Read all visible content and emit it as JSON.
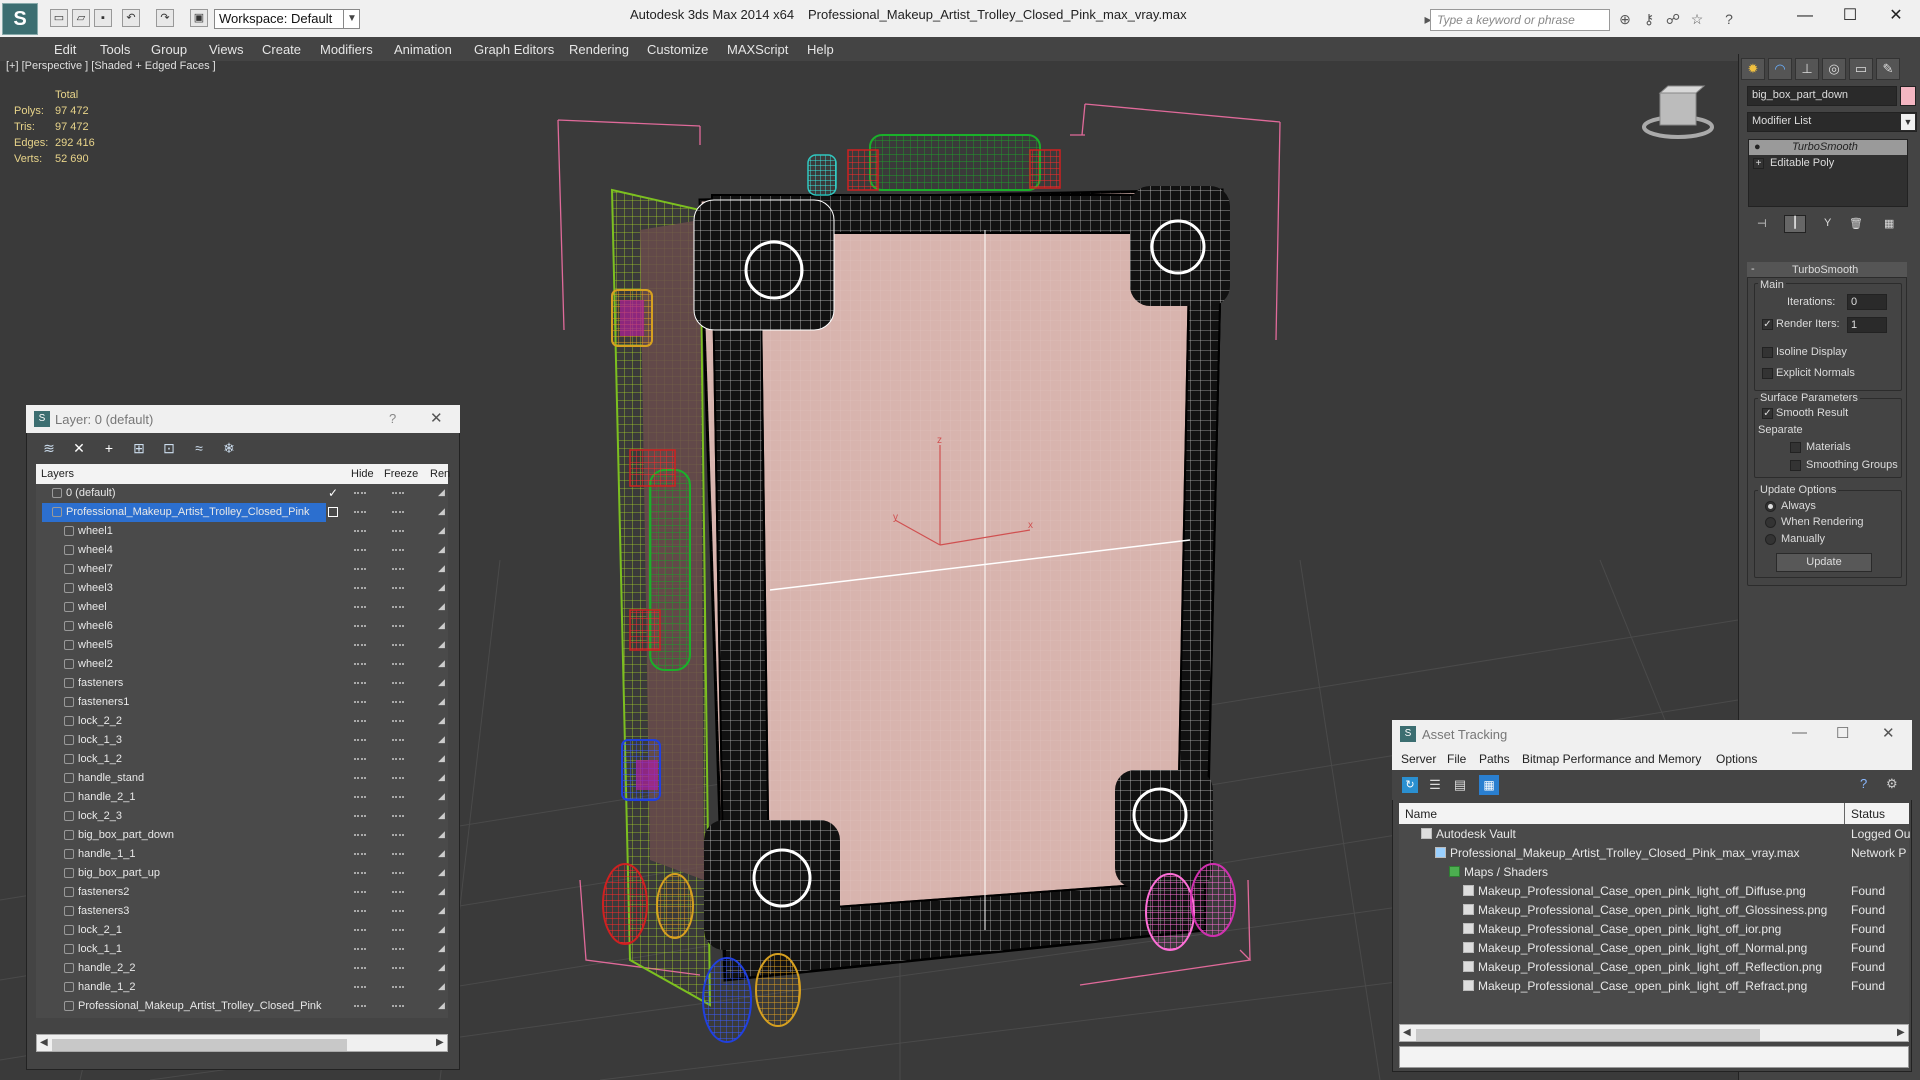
{
  "titlebar": {
    "workspace": "Workspace: Default",
    "app_title": "Autodesk 3ds Max  2014 x64",
    "file_title": "Professional_Makeup_Artist_Trolley_Closed_Pink_max_vray.max",
    "search_placeholder": "Type a keyword or phrase"
  },
  "menu": [
    "Edit",
    "Tools",
    "Group",
    "Views",
    "Create",
    "Modifiers",
    "Animation",
    "Graph Editors",
    "Rendering",
    "Customize",
    "MAXScript",
    "Help"
  ],
  "viewport": {
    "label": "[+] [Perspective ] [Shaded + Edged Faces ]",
    "stats_header": "Total",
    "stats": [
      {
        "label": "Polys:",
        "value": "97 472"
      },
      {
        "label": "Tris:",
        "value": "97 472"
      },
      {
        "label": "Edges:",
        "value": "292 416"
      },
      {
        "label": "Verts:",
        "value": "52 690"
      }
    ],
    "axis_labels": {
      "z": "z",
      "y": "y",
      "x": "x"
    }
  },
  "command_panel": {
    "object_name": "big_box_part_down",
    "object_color": "#f4b6c2",
    "modifier_list": "Modifier List",
    "stack": [
      "TurboSmooth",
      "Editable Poly"
    ],
    "rollout_title": "TurboSmooth",
    "main_label": "Main",
    "iterations_label": "Iterations:",
    "iterations_value": "0",
    "render_iters_label": "Render Iters:",
    "render_iters_value": "1",
    "isoline": "Isoline Display",
    "explicit_normals": "Explicit Normals",
    "surface_params": "Surface Parameters",
    "smooth_result": "Smooth Result",
    "separate": "Separate",
    "materials": "Materials",
    "smoothing_groups": "Smoothing Groups",
    "update_options": "Update Options",
    "always": "Always",
    "when_rendering": "When Rendering",
    "manually": "Manually",
    "update_button": "Update"
  },
  "layer_window": {
    "title": "Layer: 0 (default)",
    "help": "?",
    "headers": {
      "layers": "Layers",
      "hide": "Hide",
      "freeze": "Freeze",
      "render": "Ren"
    },
    "layers": [
      {
        "name": "0 (default)",
        "indent": 1,
        "kind": "layer",
        "checked": true
      },
      {
        "name": "Professional_Makeup_Artist_Trolley_Closed_Pink",
        "indent": 1,
        "kind": "layer",
        "selected": true
      },
      {
        "name": "wheel1",
        "indent": 2,
        "kind": "obj"
      },
      {
        "name": "wheel4",
        "indent": 2,
        "kind": "obj"
      },
      {
        "name": "wheel7",
        "indent": 2,
        "kind": "obj"
      },
      {
        "name": "wheel3",
        "indent": 2,
        "kind": "obj"
      },
      {
        "name": "wheel",
        "indent": 2,
        "kind": "obj"
      },
      {
        "name": "wheel6",
        "indent": 2,
        "kind": "obj"
      },
      {
        "name": "wheel5",
        "indent": 2,
        "kind": "obj"
      },
      {
        "name": "wheel2",
        "indent": 2,
        "kind": "obj"
      },
      {
        "name": "fasteners",
        "indent": 2,
        "kind": "obj"
      },
      {
        "name": "fasteners1",
        "indent": 2,
        "kind": "obj"
      },
      {
        "name": "lock_2_2",
        "indent": 2,
        "kind": "obj"
      },
      {
        "name": "lock_1_3",
        "indent": 2,
        "kind": "obj"
      },
      {
        "name": "lock_1_2",
        "indent": 2,
        "kind": "obj"
      },
      {
        "name": "handle_stand",
        "indent": 2,
        "kind": "obj"
      },
      {
        "name": "handle_2_1",
        "indent": 2,
        "kind": "obj"
      },
      {
        "name": "lock_2_3",
        "indent": 2,
        "kind": "obj"
      },
      {
        "name": "big_box_part_down",
        "indent": 2,
        "kind": "obj"
      },
      {
        "name": "handle_1_1",
        "indent": 2,
        "kind": "obj"
      },
      {
        "name": "big_box_part_up",
        "indent": 2,
        "kind": "obj"
      },
      {
        "name": "fasteners2",
        "indent": 2,
        "kind": "obj"
      },
      {
        "name": "fasteners3",
        "indent": 2,
        "kind": "obj"
      },
      {
        "name": "lock_2_1",
        "indent": 2,
        "kind": "obj"
      },
      {
        "name": "lock_1_1",
        "indent": 2,
        "kind": "obj"
      },
      {
        "name": "handle_2_2",
        "indent": 2,
        "kind": "obj"
      },
      {
        "name": "handle_1_2",
        "indent": 2,
        "kind": "obj"
      },
      {
        "name": "Professional_Makeup_Artist_Trolley_Closed_Pink",
        "indent": 2,
        "kind": "obj"
      }
    ]
  },
  "asset_tracking": {
    "title": "Asset Tracking",
    "menu": [
      "Server",
      "File",
      "Paths",
      "Bitmap Performance and Memory",
      "Options"
    ],
    "headers": {
      "name": "Name",
      "status": "Status"
    },
    "rows": [
      {
        "name": "Autodesk Vault",
        "status": "Logged Ou",
        "indent": 1
      },
      {
        "name": "Professional_Makeup_Artist_Trolley_Closed_Pink_max_vray.max",
        "status": "Network P",
        "indent": 2
      },
      {
        "name": "Maps / Shaders",
        "status": "",
        "indent": 3
      },
      {
        "name": "Makeup_Professional_Case_open_pink_light_off_Diffuse.png",
        "status": "Found",
        "indent": 4
      },
      {
        "name": "Makeup_Professional_Case_open_pink_light_off_Glossiness.png",
        "status": "Found",
        "indent": 4
      },
      {
        "name": "Makeup_Professional_Case_open_pink_light_off_ior.png",
        "status": "Found",
        "indent": 4
      },
      {
        "name": "Makeup_Professional_Case_open_pink_light_off_Normal.png",
        "status": "Found",
        "indent": 4
      },
      {
        "name": "Makeup_Professional_Case_open_pink_light_off_Reflection.png",
        "status": "Found",
        "indent": 4
      },
      {
        "name": "Makeup_Professional_Case_open_pink_light_off_Refract.png",
        "status": "Found",
        "indent": 4
      }
    ]
  }
}
